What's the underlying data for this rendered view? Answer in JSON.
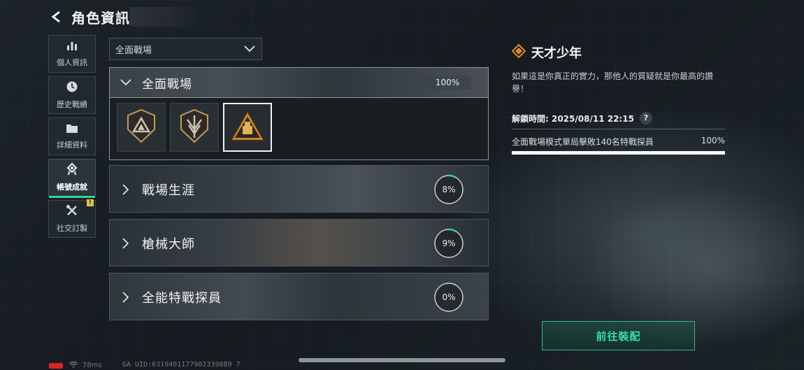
{
  "header": {
    "title": "角色資訊"
  },
  "sidebar": {
    "items": [
      {
        "label": "個人資訊",
        "icon": "bar-chart-icon"
      },
      {
        "label": "歷史戰績",
        "icon": "clock-icon"
      },
      {
        "label": "詳細資料",
        "icon": "folder-icon"
      },
      {
        "label": "帳號成就",
        "icon": "medal-icon",
        "active": true
      },
      {
        "label": "社交訂製",
        "icon": "wrench-icon",
        "notice": "!"
      }
    ]
  },
  "filter": {
    "selected": "全面戰場"
  },
  "categories": [
    {
      "name": "全面戰場",
      "expanded": true,
      "percent": "100%",
      "progress": 1.0
    },
    {
      "name": "戰場生涯",
      "percent": "8%",
      "progress": 0.08
    },
    {
      "name": "槍械大師",
      "percent": "9%",
      "progress": 0.09
    },
    {
      "name": "全能特戰探員",
      "percent": "0%",
      "progress": 0.0
    }
  ],
  "badges": [
    {
      "icon": "triangle-badge-icon",
      "selected": false
    },
    {
      "icon": "arrow-badge-icon",
      "selected": false
    },
    {
      "icon": "gold-triangle-badge-icon",
      "selected": true
    }
  ],
  "achievement": {
    "title": "天才少年",
    "description": "如果這是你真正的實力，那他人的質疑就是你最高的讚譽！",
    "unlock_label": "解鎖時間: 2025/08/11 22:15",
    "help": "?",
    "requirement": "全面戰場模式單局擊敗140名特戰探員",
    "req_percent": "100%",
    "progress": 1.0
  },
  "actions": {
    "equip": "前往裝配"
  },
  "status": {
    "ping": "78ms",
    "uid": "GA UID:6319491177902339889 7"
  },
  "colors": {
    "accent": "#33d39a",
    "gold": "#d9a441"
  }
}
